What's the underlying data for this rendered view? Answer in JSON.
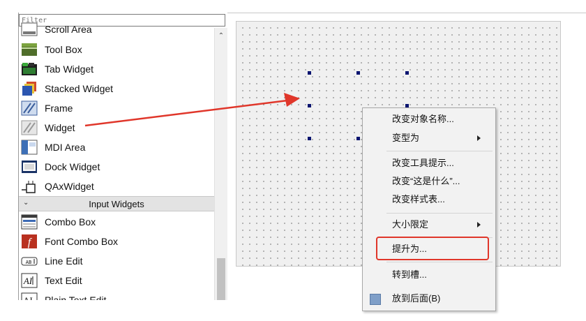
{
  "widget_box": {
    "filter_placeholder": "Filter",
    "items": [
      {
        "label": "Scroll Area",
        "icon": "scroll-area-icon"
      },
      {
        "label": "Tool Box",
        "icon": "tool-box-icon"
      },
      {
        "label": "Tab Widget",
        "icon": "tab-widget-icon"
      },
      {
        "label": "Stacked Widget",
        "icon": "stacked-widget-icon"
      },
      {
        "label": "Frame",
        "icon": "frame-icon"
      },
      {
        "label": "Widget",
        "icon": "widget-icon"
      },
      {
        "label": "MDI Area",
        "icon": "mdi-area-icon"
      },
      {
        "label": "Dock Widget",
        "icon": "dock-widget-icon"
      },
      {
        "label": "QAxWidget",
        "icon": "qaxwidget-icon"
      }
    ],
    "category": {
      "label": "Input Widgets",
      "icon": "chevron-down-icon"
    },
    "input_items": [
      {
        "label": "Combo Box",
        "icon": "combo-box-icon"
      },
      {
        "label": "Font Combo Box",
        "icon": "font-combo-box-icon"
      },
      {
        "label": "Line Edit",
        "icon": "line-edit-icon"
      },
      {
        "label": "Text Edit",
        "icon": "text-edit-icon"
      },
      {
        "label": "Plain Text Edit",
        "icon": "plain-text-edit-icon"
      }
    ]
  },
  "context_menu": {
    "items": [
      {
        "label": "改变对象名称...",
        "submenu": false
      },
      {
        "label": "变型为",
        "submenu": true
      },
      {
        "label": "改变工具提示...",
        "submenu": false
      },
      {
        "label": "改变“这是什么”...",
        "submenu": false
      },
      {
        "label": "改变样式表...",
        "submenu": false
      },
      {
        "label": "大小限定",
        "submenu": true
      },
      {
        "label": "提升为...",
        "submenu": false
      },
      {
        "label": "转到槽...",
        "submenu": false
      },
      {
        "label": "放到后面(B)",
        "submenu": false
      }
    ]
  },
  "colors": {
    "annotation_red": "#e0362a",
    "selection_handle": "#0a1570",
    "form_background": "#f0f0f0"
  }
}
